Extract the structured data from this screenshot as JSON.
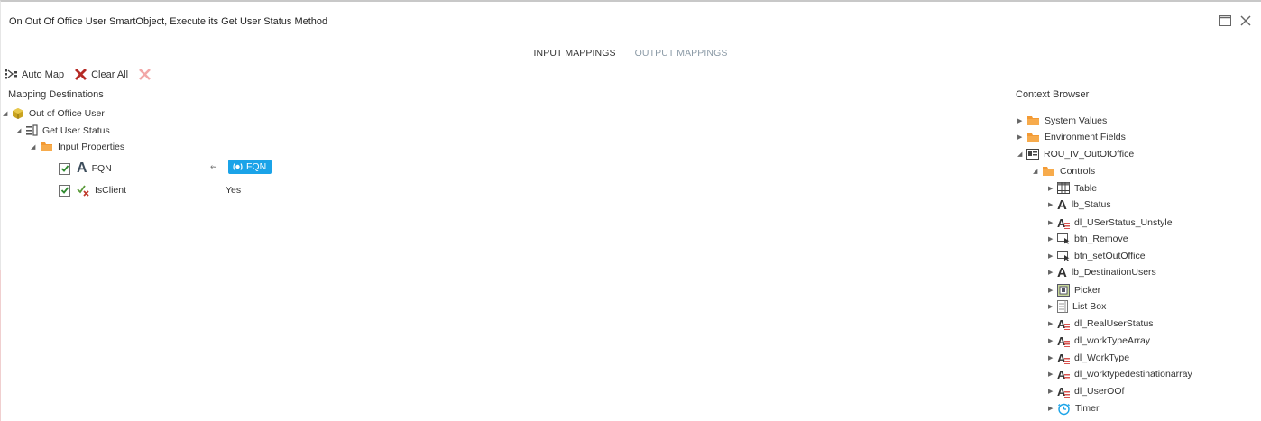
{
  "window": {
    "title": "On Out Of Office User SmartObject, Execute its Get User Status Method",
    "maximize_icon": "maximize-icon",
    "close_icon": "close-icon"
  },
  "tabs": [
    {
      "label": "INPUT MAPPINGS",
      "active": true
    },
    {
      "label": "OUTPUT MAPPINGS",
      "active": false
    }
  ],
  "toolbar": {
    "auto_map_label": "Auto Map",
    "clear_all_label": "Clear All"
  },
  "mapping": {
    "title": "Mapping Destinations",
    "root": "Out of Office User",
    "method": "Get User Status",
    "folder": "Input Properties",
    "rows": [
      {
        "label": "FQN",
        "checked": true,
        "mapped_to": "FQN"
      },
      {
        "label": "IsClient",
        "checked": true,
        "value": "Yes"
      }
    ]
  },
  "context": {
    "title": "Context Browser",
    "items": [
      {
        "label": "System Values",
        "icon": "folder-icon"
      },
      {
        "label": "Environment Fields",
        "icon": "folder-icon"
      },
      {
        "label": "ROU_IV_OutOfOffice",
        "icon": "view-icon"
      },
      {
        "label": "Controls",
        "icon": "folder-icon"
      },
      {
        "label": "Table",
        "icon": "table-icon"
      },
      {
        "label": "lb_Status",
        "icon": "label-icon"
      },
      {
        "label": "dl_USerStatus_Unstyle",
        "icon": "datalabel-icon"
      },
      {
        "label": "btn_Remove",
        "icon": "button-icon"
      },
      {
        "label": "btn_setOutOffice",
        "icon": "button-icon"
      },
      {
        "label": "lb_DestinationUsers",
        "icon": "label-icon"
      },
      {
        "label": "Picker",
        "icon": "picker-icon"
      },
      {
        "label": "List Box",
        "icon": "listbox-icon"
      },
      {
        "label": "dl_RealUserStatus",
        "icon": "datalabel-icon"
      },
      {
        "label": "dl_workTypeArray",
        "icon": "datalabel-icon"
      },
      {
        "label": "dl_WorkType",
        "icon": "datalabel-icon"
      },
      {
        "label": "dl_worktypedestinationarray",
        "icon": "datalabel-icon"
      },
      {
        "label": "dl_UserOOf",
        "icon": "datalabel-icon"
      },
      {
        "label": "Timer",
        "icon": "timer-icon"
      }
    ]
  },
  "colors": {
    "accent": "#1aa3e8",
    "folder": "#f39a34",
    "clear_red": "#c0392b"
  }
}
